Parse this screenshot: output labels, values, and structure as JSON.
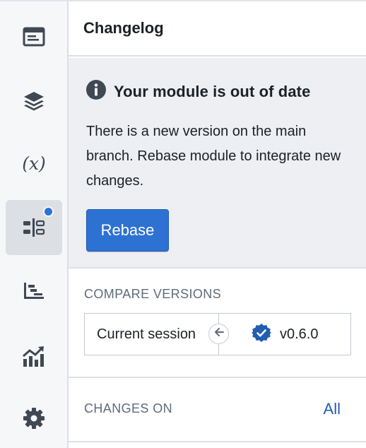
{
  "rail": {
    "items": [
      {
        "icon": "panel-window-icon",
        "active": false
      },
      {
        "icon": "layers-icon",
        "active": false
      },
      {
        "icon": "variable-icon",
        "glyph": "(x)",
        "active": false
      },
      {
        "icon": "changelog-icon",
        "active": true,
        "has_notification_dot": true
      },
      {
        "icon": "gantt-chart-icon",
        "active": false
      },
      {
        "icon": "trend-chart-icon",
        "active": false
      },
      {
        "icon": "gear-icon",
        "active": false
      }
    ]
  },
  "header": {
    "title": "Changelog"
  },
  "callout": {
    "icon": "info-sign-icon",
    "title": "Your module is out of date",
    "body": "There is a new version on the main branch. Rebase module to integrate new changes.",
    "button_label": "Rebase"
  },
  "compare": {
    "label": "COMPARE VERSIONS",
    "left": "Current session",
    "swap_icon": "arrow-left-icon",
    "right_icon": "tick-circle-icon",
    "right": "v0.6.0"
  },
  "changes": {
    "label": "CHANGES ON",
    "link": "All"
  },
  "colors": {
    "accent": "#2d72d2",
    "link": "#215db0",
    "callout_bg": "#edeff2",
    "rail_bg": "#f6f7f9",
    "muted_text": "#5f6b7c"
  }
}
